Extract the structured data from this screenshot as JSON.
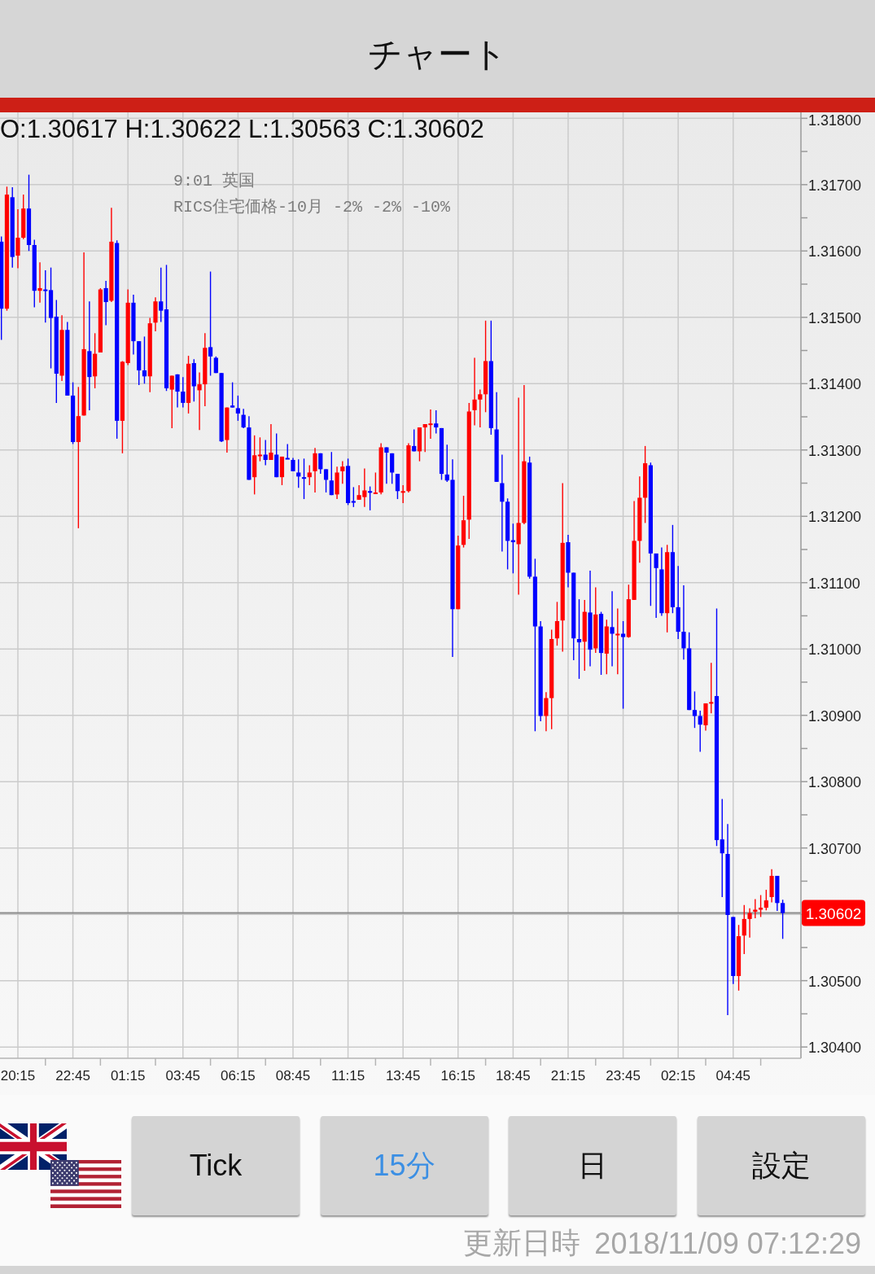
{
  "header": {
    "title": "チャート"
  },
  "chart": {
    "ohlc": "O:1.30617 H:1.30622 L:1.30563 C:1.30602",
    "annotation": [
      "9:01 英国",
      "RICS住宅価格-10月 -2% -2% -10%"
    ],
    "chart_data": {
      "type": "candlestick",
      "grid": true,
      "categories": [
        null,
        null,
        null,
        "20:15",
        null,
        null,
        null,
        null,
        null,
        null,
        null,
        null,
        null,
        "22:45",
        null,
        null,
        null,
        null,
        null,
        null,
        null,
        null,
        null,
        "01:15",
        null,
        null,
        null,
        null,
        null,
        null,
        null,
        null,
        null,
        "03:45",
        null,
        null,
        null,
        null,
        null,
        null,
        null,
        null,
        null,
        "06:15",
        null,
        null,
        null,
        null,
        null,
        null,
        null,
        null,
        null,
        "08:45",
        null,
        null,
        null,
        null,
        null,
        null,
        null,
        null,
        null,
        "11:15",
        null,
        null,
        null,
        null,
        null,
        null,
        null,
        null,
        null,
        "13:45",
        null,
        null,
        null,
        null,
        null,
        null,
        null,
        null,
        null,
        "16:15",
        null,
        null,
        null,
        null,
        null,
        null,
        null,
        null,
        null,
        "18:45",
        null,
        null,
        null,
        null,
        null,
        null,
        null,
        null,
        null,
        "21:15",
        null,
        null,
        null,
        null,
        null,
        null,
        null,
        null,
        null,
        "23:45",
        null,
        null,
        null,
        null,
        null,
        null,
        null,
        null,
        null,
        "02:15",
        null,
        null,
        null,
        null,
        null,
        null,
        null,
        null,
        null,
        "04:45",
        null,
        null,
        null,
        null,
        null,
        null,
        null,
        null,
        null
      ],
      "ohlc": [
        [
          1.31614,
          1.31622,
          1.31466,
          1.31513
        ],
        [
          1.31513,
          1.31697,
          1.3151,
          1.31685
        ],
        [
          1.31681,
          1.31696,
          1.31575,
          1.31591
        ],
        [
          1.31593,
          1.31663,
          1.31574,
          1.3162
        ],
        [
          1.3162,
          1.31685,
          1.31618,
          1.31664
        ],
        [
          1.31664,
          1.31715,
          1.316,
          1.31609
        ],
        [
          1.31609,
          1.31617,
          1.31515,
          1.3154
        ],
        [
          1.3154,
          1.31583,
          1.31522,
          1.31544
        ],
        [
          1.31542,
          1.31571,
          1.31492,
          1.3154
        ],
        [
          1.31541,
          1.31575,
          1.31423,
          1.31499
        ],
        [
          1.31501,
          1.31526,
          1.31371,
          1.31415
        ],
        [
          1.31412,
          1.31503,
          1.31404,
          1.31481
        ],
        [
          1.31481,
          1.31493,
          1.31382,
          1.31382
        ],
        [
          1.31382,
          1.31402,
          1.31309,
          1.31312
        ],
        [
          1.31312,
          1.31395,
          1.31182,
          1.31351
        ],
        [
          1.31352,
          1.31598,
          1.31352,
          1.31452
        ],
        [
          1.31449,
          1.31524,
          1.3136,
          1.3141
        ],
        [
          1.31411,
          1.31476,
          1.31393,
          1.31445
        ],
        [
          1.31447,
          1.31544,
          1.31447,
          1.31542
        ],
        [
          1.31544,
          1.31555,
          1.31488,
          1.31523
        ],
        [
          1.31525,
          1.31665,
          1.31523,
          1.31614
        ],
        [
          1.31612,
          1.31616,
          1.31317,
          1.31344
        ],
        [
          1.31344,
          1.31434,
          1.31295,
          1.31433
        ],
        [
          1.31431,
          1.31542,
          1.31428,
          1.31522
        ],
        [
          1.31522,
          1.31534,
          1.31444,
          1.31464
        ],
        [
          1.31464,
          1.31464,
          1.31398,
          1.3142
        ],
        [
          1.3142,
          1.31471,
          1.314,
          1.31411
        ],
        [
          1.31411,
          1.31499,
          1.31387,
          1.31491
        ],
        [
          1.31492,
          1.3153,
          1.31479,
          1.31524
        ],
        [
          1.31524,
          1.31575,
          1.31493,
          1.3151
        ],
        [
          1.31512,
          1.31579,
          1.31389,
          1.31393
        ],
        [
          1.31391,
          1.31412,
          1.31333,
          1.31412
        ],
        [
          1.31414,
          1.31414,
          1.31364,
          1.31388
        ],
        [
          1.31388,
          1.3141,
          1.31364,
          1.31371
        ],
        [
          1.31371,
          1.31442,
          1.31355,
          1.3143
        ],
        [
          1.31431,
          1.31437,
          1.31373,
          1.31396
        ],
        [
          1.3139,
          1.31417,
          1.3133,
          1.31399
        ],
        [
          1.31399,
          1.31476,
          1.31366,
          1.31454
        ],
        [
          1.31455,
          1.31569,
          1.31412,
          1.31441
        ],
        [
          1.31439,
          1.31441,
          1.31416,
          1.31416
        ],
        [
          1.31416,
          1.31416,
          1.31312,
          1.31313
        ],
        [
          1.31315,
          1.31364,
          1.31296,
          1.31364
        ],
        [
          1.31367,
          1.31402,
          1.31364,
          1.31364
        ],
        [
          1.31363,
          1.31382,
          1.31344,
          1.31355
        ],
        [
          1.31353,
          1.31362,
          1.31333,
          1.31334
        ],
        [
          1.31334,
          1.31351,
          1.31255,
          1.31255
        ],
        [
          1.31259,
          1.31322,
          1.31233,
          1.31292
        ],
        [
          1.31291,
          1.31319,
          1.31283,
          1.31293
        ],
        [
          1.31293,
          1.31315,
          1.31277,
          1.31285
        ],
        [
          1.31285,
          1.31339,
          1.31285,
          1.31296
        ],
        [
          1.31293,
          1.31325,
          1.31259,
          1.31259
        ],
        [
          1.31259,
          1.3129,
          1.31247,
          1.3129
        ],
        [
          1.31288,
          1.31309,
          1.31287,
          1.31287
        ],
        [
          1.31285,
          1.31288,
          1.31268,
          1.31268
        ],
        [
          1.31266,
          1.31286,
          1.31243,
          1.3126
        ],
        [
          1.31259,
          1.31287,
          1.31226,
          1.31258
        ],
        [
          1.31259,
          1.31277,
          1.31247,
          1.31266
        ],
        [
          1.31268,
          1.31303,
          1.31236,
          1.31295
        ],
        [
          1.31295,
          1.31295,
          1.31264,
          1.31271
        ],
        [
          1.31271,
          1.31271,
          1.31236,
          1.31255
        ],
        [
          1.31254,
          1.31297,
          1.31232,
          1.31232
        ],
        [
          1.31233,
          1.31275,
          1.31226,
          1.31266
        ],
        [
          1.31268,
          1.31283,
          1.31249,
          1.31275
        ],
        [
          1.31276,
          1.31287,
          1.31217,
          1.3122
        ],
        [
          1.31223,
          1.31244,
          1.31214,
          1.31222
        ],
        [
          1.31225,
          1.31247,
          1.31225,
          1.31232
        ],
        [
          1.31229,
          1.31272,
          1.31214,
          1.31239
        ],
        [
          1.31238,
          1.31245,
          1.31209,
          1.31236
        ],
        [
          1.31234,
          1.31266,
          1.31234,
          1.31236
        ],
        [
          1.31236,
          1.3131,
          1.31233,
          1.31304
        ],
        [
          1.31304,
          1.31304,
          1.31249,
          1.31296
        ],
        [
          1.31295,
          1.31295,
          1.31249,
          1.31266
        ],
        [
          1.31264,
          1.31264,
          1.31226,
          1.31238
        ],
        [
          1.31237,
          1.31247,
          1.3122,
          1.31238
        ],
        [
          1.31238,
          1.3131,
          1.31236,
          1.31307
        ],
        [
          1.31306,
          1.31331,
          1.31298,
          1.31298
        ],
        [
          1.31298,
          1.31334,
          1.31283,
          1.31334
        ],
        [
          1.31334,
          1.31339,
          1.31297,
          1.31339
        ],
        [
          1.31339,
          1.31361,
          1.31317,
          1.3134
        ],
        [
          1.3134,
          1.3136,
          1.31325,
          1.31334
        ],
        [
          1.31333,
          1.31333,
          1.31255,
          1.31264
        ],
        [
          1.31263,
          1.31308,
          1.31252,
          1.31254
        ],
        [
          1.31255,
          1.31286,
          1.30988,
          1.3106
        ],
        [
          1.3106,
          1.31171,
          1.3106,
          1.31156
        ],
        [
          1.31157,
          1.31231,
          1.31153,
          1.31194
        ],
        [
          1.31195,
          1.31371,
          1.31166,
          1.31358
        ],
        [
          1.3136,
          1.31439,
          1.31337,
          1.31376
        ],
        [
          1.31376,
          1.31391,
          1.31334,
          1.31384
        ],
        [
          1.31384,
          1.31495,
          1.31357,
          1.31434
        ],
        [
          1.31434,
          1.31495,
          1.31323,
          1.31333
        ],
        [
          1.31331,
          1.31387,
          1.31252,
          1.31252
        ],
        [
          1.3125,
          1.31293,
          1.31147,
          1.31222
        ],
        [
          1.31222,
          1.31227,
          1.3112,
          1.31163
        ],
        [
          1.31164,
          1.31189,
          1.31114,
          1.31161
        ],
        [
          1.31158,
          1.31379,
          1.31082,
          1.3119
        ],
        [
          1.3119,
          1.31398,
          1.31188,
          1.31283
        ],
        [
          1.31281,
          1.3129,
          1.31106,
          1.31109
        ],
        [
          1.31109,
          1.31136,
          1.30876,
          1.31034
        ],
        [
          1.31034,
          1.31042,
          1.30891,
          1.30899
        ],
        [
          1.30899,
          1.30935,
          1.30876,
          1.30926
        ],
        [
          1.30926,
          1.31029,
          1.30879,
          1.31015
        ],
        [
          1.31016,
          1.31071,
          1.31005,
          1.31042
        ],
        [
          1.31043,
          1.3125,
          1.30996,
          1.3116
        ],
        [
          1.31161,
          1.31172,
          1.31093,
          1.31115
        ],
        [
          1.31115,
          1.31115,
          1.30983,
          1.31016
        ],
        [
          1.31015,
          1.31075,
          1.30955,
          1.3101
        ],
        [
          1.31011,
          1.31074,
          1.30967,
          1.31056
        ],
        [
          1.31055,
          1.31118,
          1.30974,
          1.30999
        ],
        [
          1.31001,
          1.31093,
          1.30994,
          1.31052
        ],
        [
          1.31053,
          1.31056,
          1.30961,
          1.30994
        ],
        [
          1.30993,
          1.31044,
          1.30962,
          1.31034
        ],
        [
          1.31033,
          1.31087,
          1.30974,
          1.31023
        ],
        [
          1.31022,
          1.31061,
          1.30962,
          1.31023
        ],
        [
          1.31023,
          1.31042,
          1.3091,
          1.31018
        ],
        [
          1.31018,
          1.31097,
          1.31017,
          1.31075
        ],
        [
          1.31074,
          1.31223,
          1.31074,
          1.31163
        ],
        [
          1.31163,
          1.3126,
          1.3113,
          1.31228
        ],
        [
          1.31228,
          1.31306,
          1.3119,
          1.3128
        ],
        [
          1.31277,
          1.31281,
          1.31065,
          1.31144
        ],
        [
          1.31144,
          1.31144,
          1.31047,
          1.31122
        ],
        [
          1.3112,
          1.31153,
          1.3105,
          1.31054
        ],
        [
          1.31054,
          1.31157,
          1.31025,
          1.31146
        ],
        [
          1.31146,
          1.31187,
          1.31054,
          1.31063
        ],
        [
          1.31063,
          1.31125,
          1.31015,
          1.31026
        ],
        [
          1.31026,
          1.31096,
          1.30984,
          1.31001
        ],
        [
          1.31001,
          1.31025,
          1.30908,
          1.30908
        ],
        [
          1.30908,
          1.30936,
          1.30881,
          1.30899
        ],
        [
          1.30899,
          1.30907,
          1.30845,
          1.30886
        ],
        [
          1.30885,
          1.30918,
          1.30877,
          1.30918
        ],
        [
          1.30919,
          1.30979,
          1.30903,
          1.3092
        ],
        [
          1.30929,
          1.31061,
          1.30703,
          1.30712
        ],
        [
          1.30713,
          1.30774,
          1.30626,
          1.30692
        ],
        [
          1.30691,
          1.30736,
          1.30448,
          1.30599
        ],
        [
          1.30596,
          1.30596,
          1.30495,
          1.30507
        ],
        [
          1.30507,
          1.30584,
          1.30485,
          1.30567
        ],
        [
          1.30568,
          1.30614,
          1.3054,
          1.30593
        ],
        [
          1.30593,
          1.30609,
          1.30565,
          1.30602
        ],
        [
          1.30604,
          1.30623,
          1.30594,
          1.30607
        ],
        [
          1.30607,
          1.30629,
          1.30596,
          1.3061
        ],
        [
          1.3061,
          1.30637,
          1.30606,
          1.30621
        ],
        [
          1.30626,
          1.30668,
          1.30618,
          1.30658
        ],
        [
          1.30658,
          1.30658,
          1.30605,
          1.30617
        ],
        [
          1.30617,
          1.30622,
          1.30563,
          1.30602
        ]
      ],
      "ylim": [
        1.30383,
        1.31809
      ],
      "yticks": [
        {
          "value": 1.318,
          "label": "1.31800"
        },
        {
          "value": 1.317,
          "label": "1.31700"
        },
        {
          "value": 1.316,
          "label": "1.31600"
        },
        {
          "value": 1.315,
          "label": "1.31500"
        },
        {
          "value": 1.314,
          "label": "1.31400"
        },
        {
          "value": 1.313,
          "label": "1.31300"
        },
        {
          "value": 1.312,
          "label": "1.31200"
        },
        {
          "value": 1.311,
          "label": "1.31100"
        },
        {
          "value": 1.31,
          "label": "1.31000"
        },
        {
          "value": 1.309,
          "label": "1.30900"
        },
        {
          "value": 1.308,
          "label": "1.30800"
        },
        {
          "value": 1.307,
          "label": "1.30700"
        },
        {
          "value": 1.305,
          "label": "1.30500"
        },
        {
          "value": 1.304,
          "label": "1.30400"
        }
      ],
      "ref_lines": [
        {
          "axis": "y",
          "value": 1.30602,
          "label": "1.30602"
        }
      ]
    }
  },
  "period_buttons": [
    {
      "label": "Tick",
      "selected": false
    },
    {
      "label": "15分",
      "selected": true
    },
    {
      "label": "日",
      "selected": false
    }
  ],
  "settings_button": {
    "label": "設定"
  },
  "status": {
    "label": "更新日時",
    "value": "2018/11/09 07:12:29"
  }
}
